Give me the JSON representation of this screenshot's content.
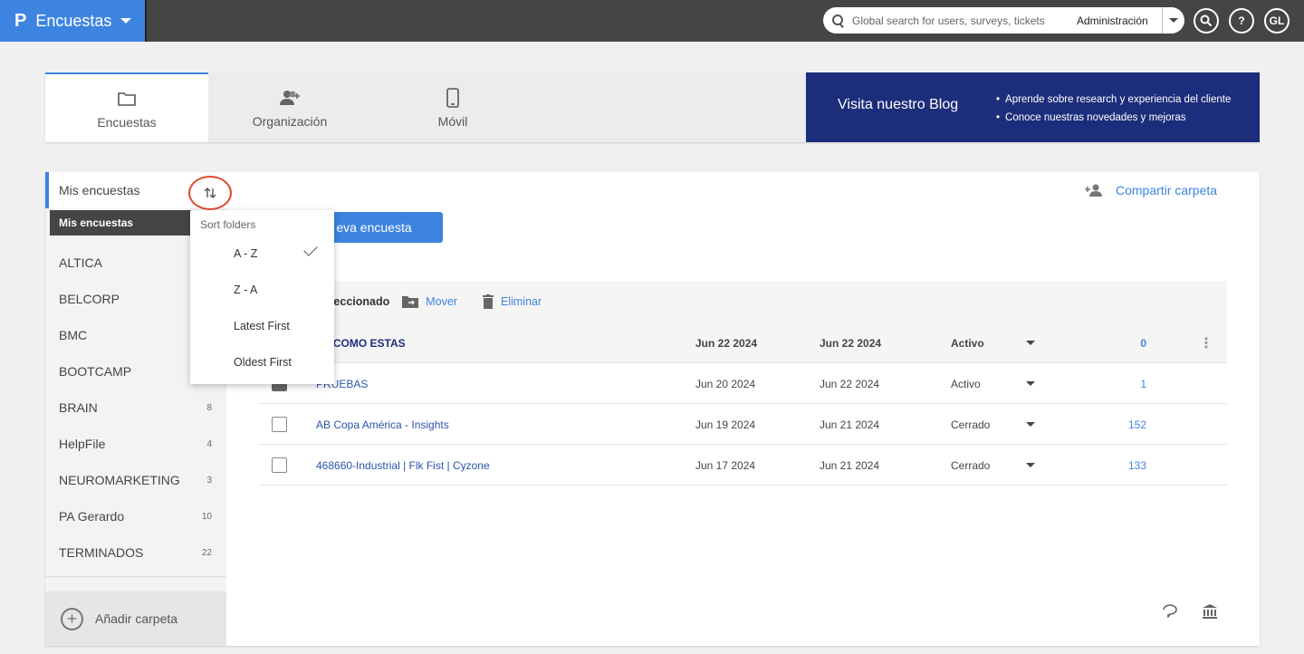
{
  "topbar": {
    "logo": "P",
    "app_title": "Encuestas",
    "search_placeholder": "Global search for users, surveys, tickets",
    "search_scope": "Administración",
    "user_initials": "GL",
    "help_label": "?"
  },
  "header_tabs": [
    {
      "label": "Encuestas",
      "icon": "folder-icon",
      "active": true
    },
    {
      "label": "Organización",
      "icon": "users-add-icon",
      "active": false
    },
    {
      "label": "Móvil",
      "icon": "mobile-icon",
      "active": false
    }
  ],
  "blog": {
    "title": "Visita nuestro Blog",
    "bullets": [
      "Aprende sobre research y experiencia del cliente",
      "Conoce nuestras novedades y mejoras"
    ]
  },
  "sidebar": {
    "header": "Mis encuestas",
    "tooltip": "Mis encuestas",
    "folders": [
      {
        "name": "ALTICA",
        "count": ""
      },
      {
        "name": "BELCORP",
        "count": ""
      },
      {
        "name": "BMC",
        "count": ""
      },
      {
        "name": "BOOTCAMP",
        "count": ""
      },
      {
        "name": "BRAIN",
        "count": "8"
      },
      {
        "name": "HelpFile",
        "count": "4"
      },
      {
        "name": "NEUROMARKETING",
        "count": "3"
      },
      {
        "name": "PA Gerardo",
        "count": "10"
      },
      {
        "name": "TERMINADOS",
        "count": "22"
      }
    ],
    "add_folder": "Añadir carpeta",
    "add_symbol": "+"
  },
  "sort_menu": {
    "title": "Sort folders",
    "options": [
      "A - Z",
      "Z - A",
      "Latest First",
      "Oldest First"
    ],
    "selected": "A - Z"
  },
  "share_label": "Compartir carpeta",
  "new_survey_label": "eva encuesta",
  "toolbar": {
    "selected_label": "eleccionado",
    "move_label": "Mover",
    "delete_label": "Eliminar"
  },
  "surveys": [
    {
      "name": "LA COMO ESTAS",
      "created": "Jun 22 2024",
      "modified": "Jun 22 2024",
      "status": "Activo",
      "responses": "0",
      "checked": false
    },
    {
      "name": "PRUEBAS",
      "created": "Jun 20 2024",
      "modified": "Jun 22 2024",
      "status": "Activo",
      "responses": "1",
      "checked": true
    },
    {
      "name": "AB Copa América - Insights",
      "created": "Jun 19 2024",
      "modified": "Jun 21 2024",
      "status": "Cerrado",
      "responses": "152",
      "checked": false
    },
    {
      "name": "468660-Industrial | Flk Fist | Cyzone",
      "created": "Jun 17 2024",
      "modified": "Jun 21 2024",
      "status": "Cerrado",
      "responses": "133",
      "checked": false
    }
  ],
  "colors": {
    "brand_blue": "#3c84e0",
    "topbar_dark": "#454545",
    "blog_navy": "#1c2e7b",
    "highlight_ring": "#e04a2f"
  }
}
